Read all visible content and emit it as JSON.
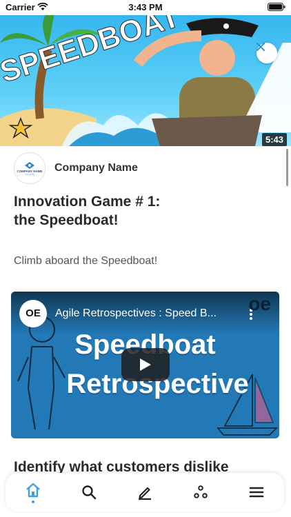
{
  "status_bar": {
    "carrier": "Carrier",
    "time": "3:43 PM"
  },
  "hero": {
    "overlay_text": "SPEEDBOAT",
    "duration": "5:43",
    "close_icon": "close-icon"
  },
  "company": {
    "name": "Company Name",
    "logo_text": "COMPANY NAME",
    "logo_sub": "TAGLINE"
  },
  "article": {
    "title_line1": "Innovation Game # 1:",
    "title_line2": "the Speedboat!",
    "subtitle": "Climb aboard the Speedboat!",
    "next_heading": "Identify what customers dislike"
  },
  "video": {
    "title": "Agile Retrospectives : Speed B...",
    "channel_mark": "OE",
    "brand": "oe",
    "headline_1": "Speedboat",
    "headline_2": "Retrospective"
  },
  "tabbar": {
    "items": [
      {
        "icon": "home-icon",
        "active": true
      },
      {
        "icon": "search-icon",
        "active": false
      },
      {
        "icon": "edit-icon",
        "active": false
      },
      {
        "icon": "dots-icon",
        "active": false
      },
      {
        "icon": "menu-icon",
        "active": false
      }
    ],
    "active_color": "#3aa0e8",
    "icon_color": "#222222"
  }
}
